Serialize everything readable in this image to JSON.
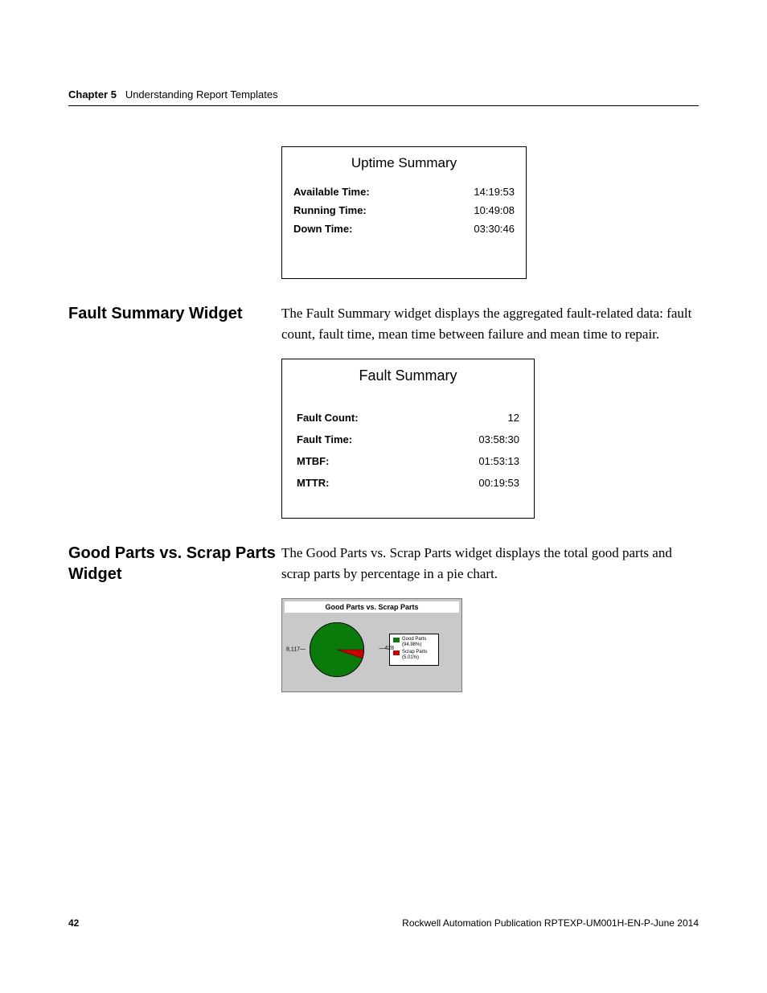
{
  "header": {
    "chapter": "Chapter 5",
    "title": "Understanding Report Templates"
  },
  "uptime": {
    "title": "Uptime Summary",
    "rows": {
      "available_label": "Available Time:",
      "available_value": "14:19:53",
      "running_label": "Running Time:",
      "running_value": "10:49:08",
      "down_label": "Down Time:",
      "down_value": "03:30:46"
    }
  },
  "fault": {
    "heading": "Fault Summary Widget",
    "text": "The Fault Summary widget displays the aggregated fault-related data: fault count, fault time, mean time between failure and mean time to repair.",
    "title": "Fault Summary",
    "rows": {
      "count_label": "Fault Count:",
      "count_value": "12",
      "time_label": "Fault Time:",
      "time_value": "03:58:30",
      "mtbf_label": "MTBF:",
      "mtbf_value": "01:53:13",
      "mttr_label": "MTTR:",
      "mttr_value": "00:19:53"
    }
  },
  "goodparts": {
    "heading": "Good Parts vs. Scrap Parts Widget",
    "text": "The Good Parts vs. Scrap Parts widget displays the total good parts and scrap parts by percentage in a pie chart.",
    "card_title": "Good Parts vs. Scrap Parts",
    "label_good": "8,117",
    "label_scrap": "428",
    "legend_good": "Good Parts (94.98%)",
    "legend_scrap": "Scrap Parts (5.01%)"
  },
  "footer": {
    "page": "42",
    "pub": "Rockwell Automation Publication RPTEXP-UM001H-EN-P-June 2014"
  },
  "chart_data": {
    "type": "pie",
    "title": "Good Parts vs. Scrap Parts",
    "series": [
      {
        "name": "Good Parts",
        "value": 8117,
        "percent": 94.98,
        "color": "#0a7a0a"
      },
      {
        "name": "Scrap Parts",
        "value": 428,
        "percent": 5.01,
        "color": "#cc0000"
      }
    ]
  }
}
